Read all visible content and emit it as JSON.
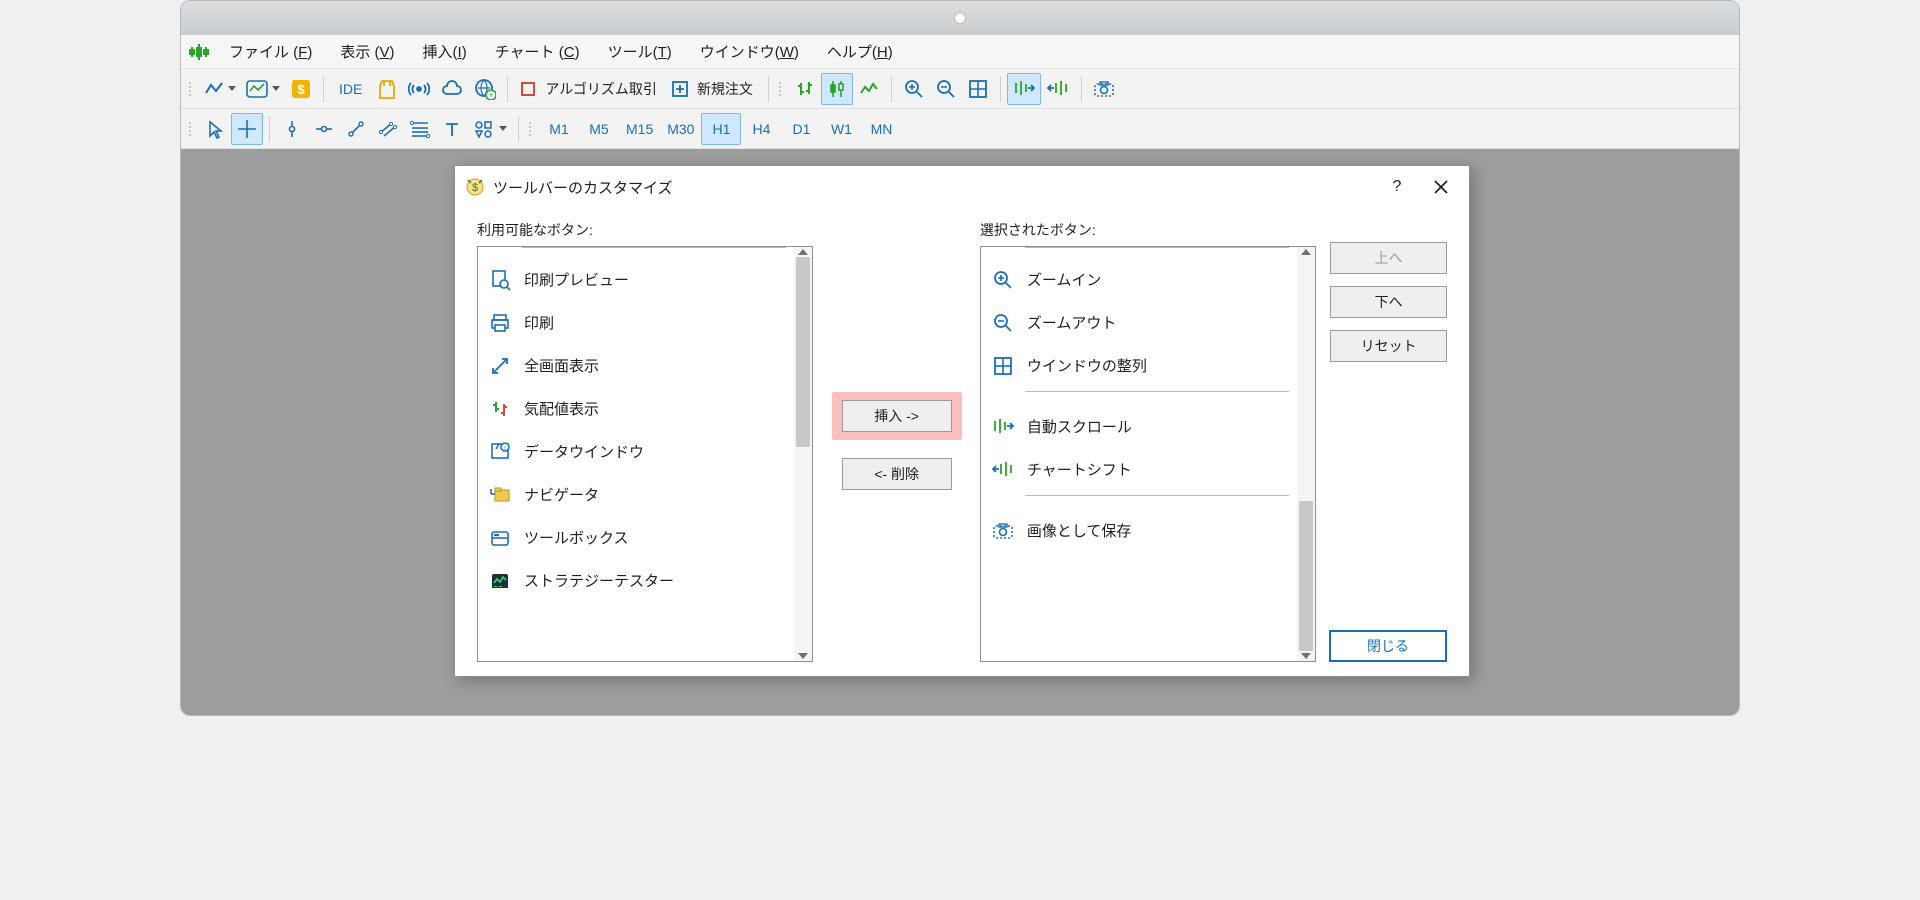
{
  "menu": {
    "items": [
      {
        "pre": "ファイル (",
        "mn": "F",
        "post": ")"
      },
      {
        "pre": "表示 (",
        "mn": "V",
        "post": ")"
      },
      {
        "pre": "挿入(",
        "mn": "I",
        "post": ")"
      },
      {
        "pre": "チャート (",
        "mn": "C",
        "post": ")"
      },
      {
        "pre": "ツール(",
        "mn": "T",
        "post": ")"
      },
      {
        "pre": "ウインドウ(",
        "mn": "W",
        "post": ")"
      },
      {
        "pre": "ヘルプ(",
        "mn": "H",
        "post": ")"
      }
    ]
  },
  "toolbar": {
    "ide_label": "IDE",
    "algo_label": "アルゴリズム取引",
    "new_order_label": "新規注文"
  },
  "timeframes": [
    "M1",
    "M5",
    "M15",
    "M30",
    "H1",
    "H4",
    "D1",
    "W1",
    "MN"
  ],
  "active_timeframe": "H1",
  "dialog": {
    "title": "ツールバーのカスタマイズ",
    "available_label": "利用可能なボタン:",
    "selected_label": "選択されたボタン:",
    "insert_btn": "挿入 ->",
    "remove_btn": "<- 削除",
    "up_btn": "上へ",
    "down_btn": "下へ",
    "reset_btn": "リセット",
    "close_btn": "閉じる",
    "available_items": [
      "印刷プレビュー",
      "印刷",
      "全画面表示",
      "気配値表示",
      "データウインドウ",
      "ナビゲータ",
      "ツールボックス",
      "ストラテジーテスター"
    ],
    "selected_items": [
      "ズームイン",
      "ズームアウト",
      "ウインドウの整列",
      "自動スクロール",
      "チャートシフト",
      "画像として保存"
    ]
  }
}
